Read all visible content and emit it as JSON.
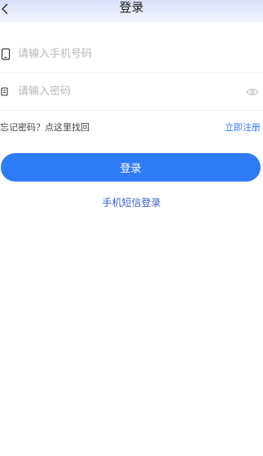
{
  "header": {
    "title": "登录",
    "back_icon": "chevron-left-icon"
  },
  "form": {
    "phone": {
      "placeholder": "请输入手机号码",
      "value": "",
      "icon": "phone-icon"
    },
    "password": {
      "placeholder": "请输入密码",
      "value": "",
      "icon": "lock-icon",
      "toggle_icon": "eye-icon"
    }
  },
  "links": {
    "forgot": "忘记密码？点这里找回",
    "register": "立即注册"
  },
  "login_button": "登录",
  "sms_login": "手机短信登录",
  "colors": {
    "primary": "#2f7bf6",
    "sms_link": "#3a5fcd",
    "header_gradient_top": "#d9defa"
  }
}
